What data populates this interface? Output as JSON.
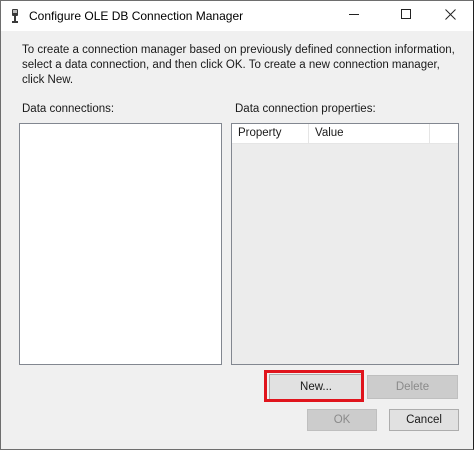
{
  "window": {
    "title": "Configure OLE DB Connection Manager",
    "icon": "ole-db-plug-icon"
  },
  "controls": {
    "minimize": "minimize-icon",
    "maximize": "maximize-icon",
    "close": "close-icon"
  },
  "description": "To create a connection manager based on previously defined connection information, select a data connection, and then click OK. To create a new connection manager, click New.",
  "data_connections": {
    "label": "Data connections:",
    "items": []
  },
  "data_connection_properties": {
    "label": "Data connection properties:",
    "columns": [
      "Property",
      "Value"
    ],
    "rows": []
  },
  "buttons": {
    "new": "New...",
    "delete": "Delete",
    "ok": "OK",
    "cancel": "Cancel"
  },
  "state": {
    "delete_enabled": false,
    "ok_enabled": false
  },
  "annotation": {
    "highlight_color": "#e0141c",
    "highlights": "new-button"
  }
}
